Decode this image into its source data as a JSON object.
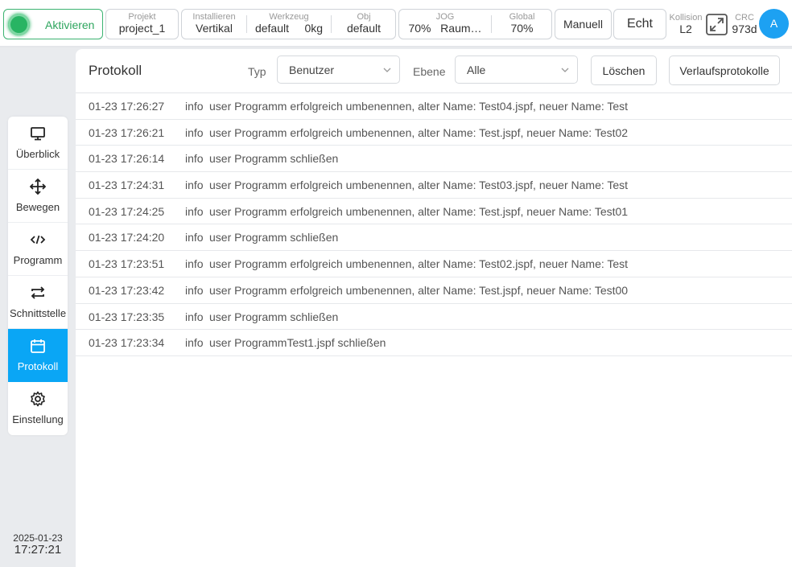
{
  "topbar": {
    "activate_label": "Aktivieren",
    "project": {
      "label": "Projekt",
      "value": "project_1"
    },
    "install": {
      "label": "Installieren",
      "value": "Vertikal"
    },
    "tool": {
      "label": "Werkzeug",
      "value": "default",
      "weight": "0kg"
    },
    "obj": {
      "label": "Obj",
      "value": "default"
    },
    "jog": {
      "label": "JOG",
      "value": "70%",
      "space": "Raum…"
    },
    "global": {
      "label": "Global",
      "value": "70%"
    },
    "mode_button": "Manuell",
    "real_button": "Echt",
    "collision": {
      "label": "Kollision",
      "value": "L2"
    },
    "crc": {
      "label": "CRC",
      "value": "973d"
    },
    "avatar_letter": "A",
    "icons": {
      "status": "status-led-icon",
      "expand": "expand-icon"
    },
    "colors": {
      "accent": "#0aa6f5",
      "active_green": "#28b463",
      "avatar": "#1da1f2"
    }
  },
  "sidebar": {
    "items": [
      {
        "label": "Überblick",
        "icon": "monitor-icon"
      },
      {
        "label": "Bewegen",
        "icon": "move-icon"
      },
      {
        "label": "Programm",
        "icon": "code-icon"
      },
      {
        "label": "Schnittstelle",
        "icon": "swap-icon"
      },
      {
        "label": "Protokoll",
        "icon": "calendar-icon",
        "active": true
      },
      {
        "label": "Einstellung",
        "icon": "gear-icon"
      }
    ],
    "date": "2025-01-23",
    "time": "17:27:21"
  },
  "main": {
    "title": "Protokoll",
    "type_label": "Typ",
    "type_value": "Benutzer",
    "level_label": "Ebene",
    "level_value": "Alle",
    "clear_button": "Löschen",
    "history_button": "Verlaufsprotokolle",
    "logs": [
      {
        "time": "01-23 17:26:27",
        "level": "info",
        "message": "user Programm erfolgreich umbenennen, alter Name: Test04.jspf, neuer Name: Test"
      },
      {
        "time": "01-23 17:26:21",
        "level": "info",
        "message": "user Programm erfolgreich umbenennen, alter Name: Test.jspf, neuer Name: Test02"
      },
      {
        "time": "01-23 17:26:14",
        "level": "info",
        "message": "user Programm schließen"
      },
      {
        "time": "01-23 17:24:31",
        "level": "info",
        "message": "user Programm erfolgreich umbenennen, alter Name: Test03.jspf, neuer Name: Test"
      },
      {
        "time": "01-23 17:24:25",
        "level": "info",
        "message": "user Programm erfolgreich umbenennen, alter Name: Test.jspf, neuer Name: Test01"
      },
      {
        "time": "01-23 17:24:20",
        "level": "info",
        "message": "user Programm schließen"
      },
      {
        "time": "01-23 17:23:51",
        "level": "info",
        "message": "user Programm erfolgreich umbenennen, alter Name: Test02.jspf, neuer Name: Test"
      },
      {
        "time": "01-23 17:23:42",
        "level": "info",
        "message": "user Programm erfolgreich umbenennen, alter Name: Test.jspf, neuer Name: Test00"
      },
      {
        "time": "01-23 17:23:35",
        "level": "info",
        "message": "user Programm schließen"
      },
      {
        "time": "01-23 17:23:34",
        "level": "info",
        "message": "user ProgrammTest1.jspf schließen"
      }
    ]
  }
}
